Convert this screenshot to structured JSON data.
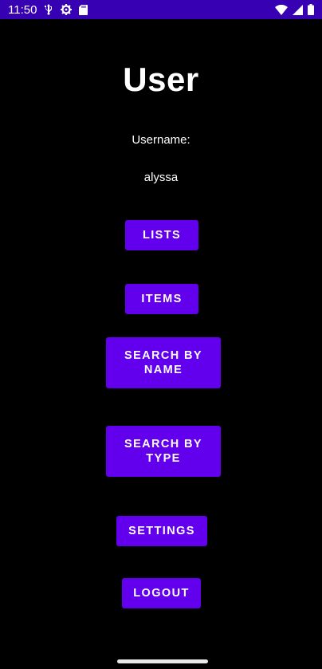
{
  "status_bar": {
    "time": "11:50",
    "left_icons": [
      "usb-debug-icon",
      "settings-gear-icon",
      "sd-card-icon"
    ],
    "right_icons": [
      "wifi-icon",
      "cellular-signal-icon",
      "battery-icon"
    ],
    "background_color": "#3700b3"
  },
  "screen": {
    "title": "User",
    "username_label": "Username:",
    "username_value": "alyssa"
  },
  "buttons": {
    "lists": "LISTS",
    "items": "ITEMS",
    "search_by_name": "SEARCH BY NAME",
    "search_by_type": "SEARCH BY TYPE",
    "settings": "SETTINGS",
    "logout": "LOGOUT"
  },
  "colors": {
    "button": "#6200ee",
    "background": "#000000",
    "text": "#ffffff"
  }
}
